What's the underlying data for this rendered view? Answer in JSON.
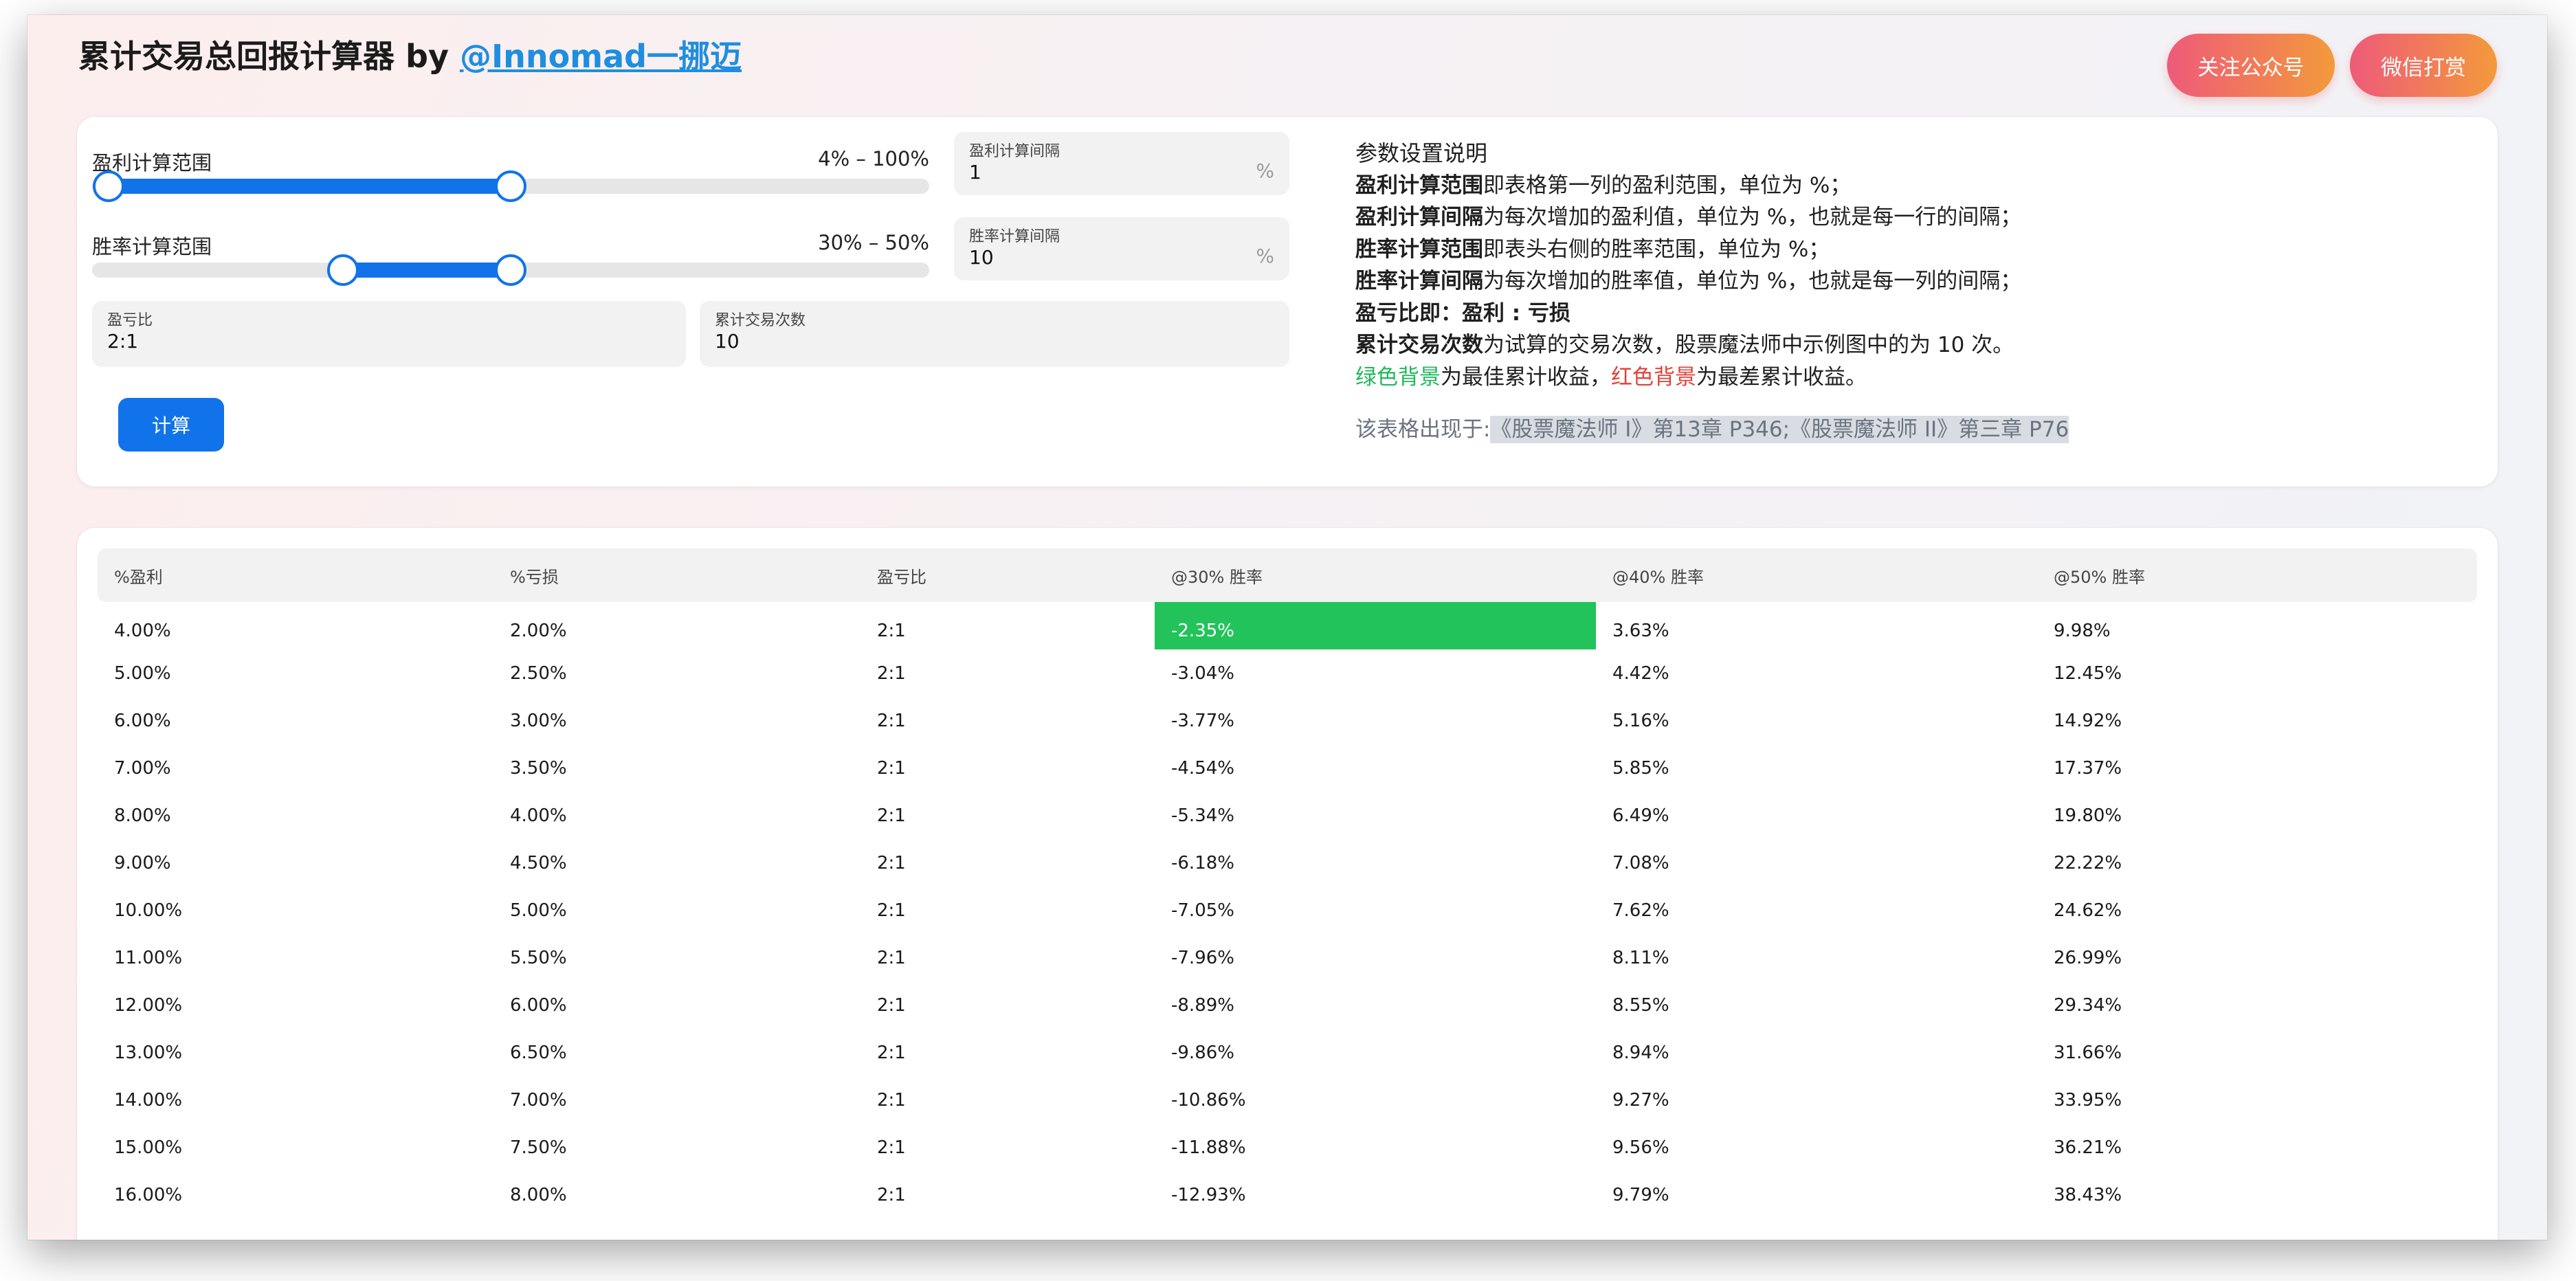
{
  "header": {
    "title": "累计交易总回报计算器 by ",
    "handle": "@Innomad一挪迈",
    "follow_button": "关注公众号",
    "tip_button": "微信打赏"
  },
  "settings": {
    "profit_range": {
      "label": "盈利计算范围",
      "value_text": "4% – 100%",
      "low": 4,
      "high": 100,
      "min": 0,
      "max": 200
    },
    "winrate_range": {
      "label": "胜率计算范围",
      "value_text": "30% – 50%",
      "low": 30,
      "high": 50,
      "min": 0,
      "max": 100
    },
    "profit_step": {
      "label": "盈利计算间隔",
      "value": "1",
      "unit": "%"
    },
    "winrate_step": {
      "label": "胜率计算间隔",
      "value": "10",
      "unit": "%"
    },
    "ratio": {
      "label": "盈亏比",
      "value": "2:1"
    },
    "trades": {
      "label": "累计交易次数",
      "value": "10"
    },
    "calc_button": "计算"
  },
  "help": {
    "title": "参数设置说明",
    "l1_bold": "盈利计算范围",
    "l1_rest": "即表格第一列的盈利范围，单位为 %；",
    "l2_bold": "盈利计算间隔",
    "l2_rest": "为每次增加的盈利值，单位为 %，也就是每一行的间隔；",
    "l3_bold": "胜率计算范围",
    "l3_rest": "即表头右侧的胜率范围，单位为 %；",
    "l4_bold": "胜率计算间隔",
    "l4_rest": "为每次增加的胜率值，单位为 %，也就是每一列的间隔；",
    "l5_bold": "盈亏比即：盈利 : 亏损",
    "l6_bold": "累计交易次数",
    "l6_rest": "为试算的交易次数，股票魔法师中示例图中的为 10 次。",
    "l7_green": "绿色背景",
    "l7_mid": "为最佳累计收益，",
    "l7_red": "红色背景",
    "l7_end": "为最差累计收益。",
    "source_prefix": "该表格出现于:",
    "source_ref": "《股票魔法师 I》第13章 P346;《股票魔法师 II》第三章 P76"
  },
  "table": {
    "headers": [
      "%盈利",
      "%亏损",
      "盈亏比",
      "@30% 胜率",
      "@40% 胜率",
      "@50% 胜率"
    ],
    "rows": [
      [
        "4.00%",
        "2.00%",
        "2:1",
        "-2.35%",
        "3.63%",
        "9.98%"
      ],
      [
        "5.00%",
        "2.50%",
        "2:1",
        "-3.04%",
        "4.42%",
        "12.45%"
      ],
      [
        "6.00%",
        "3.00%",
        "2:1",
        "-3.77%",
        "5.16%",
        "14.92%"
      ],
      [
        "7.00%",
        "3.50%",
        "2:1",
        "-4.54%",
        "5.85%",
        "17.37%"
      ],
      [
        "8.00%",
        "4.00%",
        "2:1",
        "-5.34%",
        "6.49%",
        "19.80%"
      ],
      [
        "9.00%",
        "4.50%",
        "2:1",
        "-6.18%",
        "7.08%",
        "22.22%"
      ],
      [
        "10.00%",
        "5.00%",
        "2:1",
        "-7.05%",
        "7.62%",
        "24.62%"
      ],
      [
        "11.00%",
        "5.50%",
        "2:1",
        "-7.96%",
        "8.11%",
        "26.99%"
      ],
      [
        "12.00%",
        "6.00%",
        "2:1",
        "-8.89%",
        "8.55%",
        "29.34%"
      ],
      [
        "13.00%",
        "6.50%",
        "2:1",
        "-9.86%",
        "8.94%",
        "31.66%"
      ],
      [
        "14.00%",
        "7.00%",
        "2:1",
        "-10.86%",
        "9.27%",
        "33.95%"
      ],
      [
        "15.00%",
        "7.50%",
        "2:1",
        "-11.88%",
        "9.56%",
        "36.21%"
      ],
      [
        "16.00%",
        "8.00%",
        "2:1",
        "-12.93%",
        "9.79%",
        "38.43%"
      ]
    ],
    "highlight_best": {
      "row": 0,
      "col": 3,
      "color": "#22c35a"
    }
  },
  "colors": {
    "accent": "#1173ea",
    "best": "#22c35a",
    "worst": "#e2413a",
    "link": "#1f8ee0"
  }
}
